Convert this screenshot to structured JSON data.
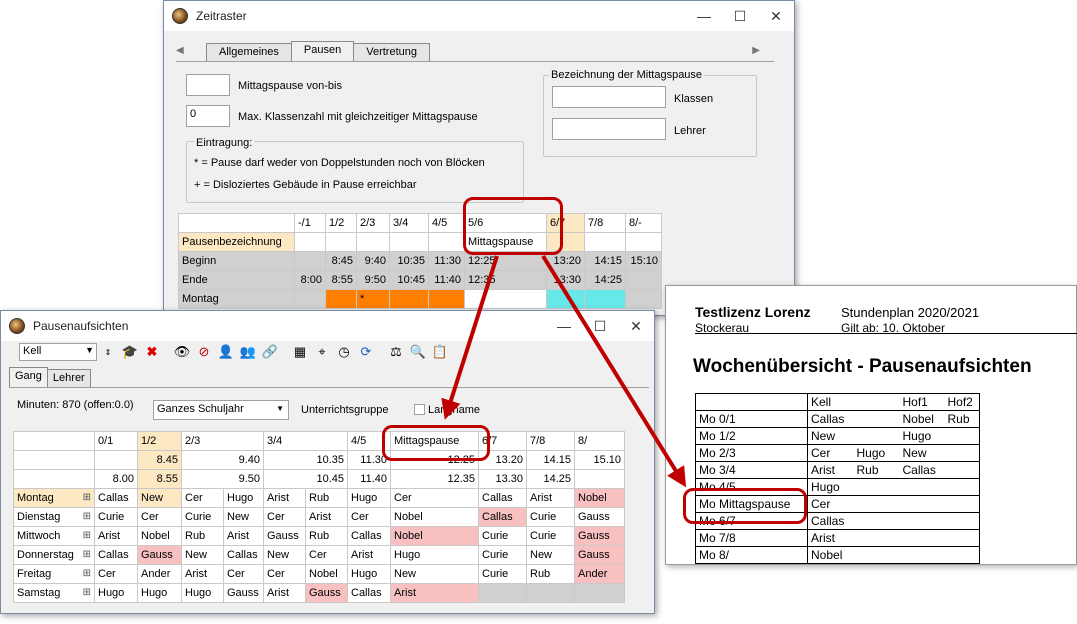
{
  "zeitraster": {
    "title": "Zeitraster",
    "tabs": [
      "Allgemeines",
      "Pausen",
      "Vertretung"
    ],
    "mittagspause_value": "",
    "mittagspause_label": "Mittagspause von-bis",
    "max_value": "0",
    "max_label": "Max. Klassenzahl mit gleichzeitiger Mittagspause",
    "eintragung_title": "Eintragung:",
    "eintragung_line1": "* = Pause darf weder von Doppelstunden noch von Blöcken",
    "eintragung_line2": "+ = Disloziertes Gebäude in Pause erreichbar",
    "bez_title": "Bezeichnung der Mittagspause",
    "klassen_label": "Klassen",
    "lehrer_label": "Lehrer",
    "grid_cols": [
      "-/1",
      "1/2",
      "2/3",
      "3/4",
      "4/5",
      "5/6",
      "6/7",
      "7/8",
      "8/-"
    ],
    "row_pausenbez": "Pausenbezeichnung",
    "mittagspause_cell": "Mittagspause",
    "row_beginn": "Beginn",
    "beginn": [
      "",
      "8:45",
      "9:40",
      "10:35",
      "11:30",
      "12:25",
      "13:20",
      "14:15",
      "15:10"
    ],
    "row_ende": "Ende",
    "ende": [
      "8:00",
      "8:55",
      "9:50",
      "10:45",
      "11:40",
      "12:35",
      "13:30",
      "14:25",
      ""
    ],
    "row_montag": "Montag",
    "montag_star": "*"
  },
  "pausen": {
    "title": "Pausenaufsichten",
    "gang_select": "Kell",
    "tabs": [
      "Gang",
      "Lehrer"
    ],
    "minuten": "Minuten: 870 (offen:0.0)",
    "schuljahr": "Ganzes Schuljahr",
    "unterrichtsgruppe": "Unterrichtsgruppe",
    "langname": "Langname",
    "cols": [
      "0/1",
      "1/2",
      "2/3",
      "3/4",
      "4/5",
      "Mittagspause",
      "6/7",
      "7/8",
      "8/"
    ],
    "row_beginn": [
      "",
      "8.45",
      "9.40",
      "10.35",
      "11.30",
      "12.25",
      "13.20",
      "14.15",
      "15.10"
    ],
    "row_ende": [
      "8.00",
      "8.55",
      "9.50",
      "10.45",
      "11.40",
      "12.35",
      "13.30",
      "14.25",
      ""
    ],
    "days": [
      {
        "name": "Montag",
        "cells": [
          "Callas",
          "New",
          "Cer",
          "Hugo",
          "Arist",
          "Rub",
          "Hugo",
          "Cer",
          "Callas",
          "Arist",
          "Nobel"
        ]
      },
      {
        "name": "Dienstag",
        "cells": [
          "Curie",
          "Cer",
          "Curie",
          "New",
          "Cer",
          "Arist",
          "Cer",
          "Nobel",
          "Callas",
          "Curie",
          "Gauss"
        ]
      },
      {
        "name": "Mittwoch",
        "cells": [
          "Arist",
          "Nobel",
          "Rub",
          "Arist",
          "Gauss",
          "Rub",
          "Callas",
          "Nobel",
          "Curie",
          "Curie",
          "Gauss"
        ]
      },
      {
        "name": "Donnerstag",
        "cells": [
          "Callas",
          "Gauss",
          "New",
          "Callas",
          "New",
          "Cer",
          "Arist",
          "Hugo",
          "Curie",
          "New",
          "Gauss"
        ]
      },
      {
        "name": "Freitag",
        "cells": [
          "Cer",
          "Ander",
          "Arist",
          "Cer",
          "Cer",
          "Nobel",
          "Hugo",
          "New",
          "Curie",
          "Rub",
          "Ander"
        ]
      },
      {
        "name": "Samstag",
        "cells": [
          "Hugo",
          "Hugo",
          "Hugo",
          "Gauss",
          "Arist",
          "Gauss",
          "Callas",
          "Arist",
          "",
          "",
          ""
        ]
      }
    ]
  },
  "report": {
    "lizenz": "Testlizenz Lorenz",
    "stundenplan": "Stundenplan 2020/2021",
    "ort": "Stockerau",
    "gilt": "Gilt ab: 10. Oktober",
    "heading": "Wochenübersicht - Pausenaufsichten",
    "header": [
      "",
      "Kell",
      "",
      "Hof1",
      "Hof2"
    ],
    "rows": [
      [
        "Mo 0/1",
        "Callas",
        "",
        "Nobel",
        "Rub"
      ],
      [
        "Mo 1/2",
        "New",
        "",
        "Hugo",
        ""
      ],
      [
        "Mo 2/3",
        "Cer",
        "Hugo",
        "New",
        ""
      ],
      [
        "Mo 3/4",
        "Arist",
        "Rub",
        "Callas",
        ""
      ],
      [
        "Mo 4/5",
        "Hugo",
        "",
        "",
        ""
      ],
      [
        "Mo Mittagspause",
        "Cer",
        "",
        "",
        ""
      ],
      [
        "Mo 6/7",
        "Callas",
        "",
        "",
        ""
      ],
      [
        "Mo 7/8",
        "Arist",
        "",
        "",
        ""
      ],
      [
        "Mo 8/",
        "Nobel",
        "",
        "",
        ""
      ]
    ]
  },
  "colors": {
    "highlight": "#c00000",
    "orange": "#ff8000",
    "cyan": "#66e8e8",
    "pink": "#f8c0c0"
  }
}
